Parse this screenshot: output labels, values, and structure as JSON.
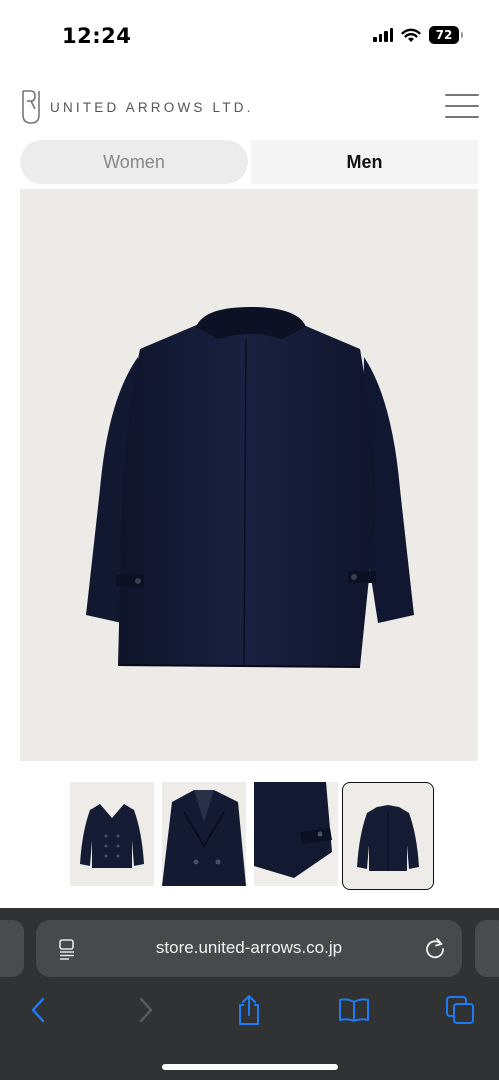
{
  "status_bar": {
    "time": "12:24",
    "battery": "72",
    "icons": [
      "signal-icon",
      "wifi-icon",
      "battery-icon"
    ]
  },
  "header": {
    "brand": "UNITED ARROWS LTD.",
    "logo_icon": "united-arrows-logo",
    "menu_icon": "hamburger-menu-icon"
  },
  "tabs": [
    {
      "label": "Women",
      "active": false
    },
    {
      "label": "Men",
      "active": true
    }
  ],
  "product": {
    "main_image": "navy-pea-coat-back-view",
    "thumbnails": [
      {
        "image": "pea-coat-front",
        "selected": false
      },
      {
        "image": "pea-coat-collar-detail",
        "selected": false
      },
      {
        "image": "pea-coat-cuff-detail",
        "selected": false
      },
      {
        "image": "pea-coat-back",
        "selected": true
      }
    ]
  },
  "browser": {
    "url": "store.united-arrows.co.jp",
    "toolbar": [
      "back-icon",
      "forward-icon",
      "share-icon",
      "bookmarks-icon",
      "tabs-icon"
    ]
  },
  "colors": {
    "accent": "#1d7cf2",
    "coat": "#151b33",
    "image_bg": "#edebe7",
    "browser_bg": "#313233"
  }
}
